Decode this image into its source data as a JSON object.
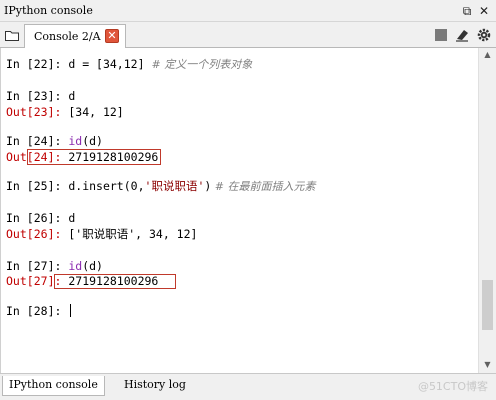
{
  "window": {
    "title": "IPython console",
    "undock_glyph": "⧉",
    "close_glyph": "✕"
  },
  "tabbar": {
    "tab_label": "Console 2/A",
    "tab_close_glyph": "✕"
  },
  "console": {
    "lines": [
      {
        "prompt": "In [",
        "num": "22",
        "close": "]: ",
        "code": "d = [34,12]",
        "comment": "  # 定义一个列表对象"
      },
      {
        "prompt": "In [",
        "num": "23",
        "close": "]: ",
        "code": "d"
      },
      {
        "prompt": "Out[",
        "num": "23",
        "close": "]: ",
        "code": "[34, 12]"
      },
      {
        "prompt": "In [",
        "num": "24",
        "close": "]: ",
        "code_kw": "id",
        "code_rest": "(d)"
      },
      {
        "prompt": "Out[",
        "num": "24",
        "close": "]: ",
        "code": "2719128100296"
      },
      {
        "prompt": "In [",
        "num": "25",
        "close": "]: ",
        "code_pre": "d.insert(0,",
        "code_str": "'职说职语'",
        "code_post": ")",
        "comment": " # 在最前面插入元素"
      },
      {
        "prompt": "In [",
        "num": "26",
        "close": "]: ",
        "code": "d"
      },
      {
        "prompt": "Out[",
        "num": "26",
        "close": "]: ",
        "code_pre": "[",
        "code_str": "'职说职语'",
        "code_post": ", 34, 12]"
      },
      {
        "prompt": "In [",
        "num": "27",
        "close": "]: ",
        "code_kw": "id",
        "code_rest": "(d)"
      },
      {
        "prompt": "Out[",
        "num": "27",
        "close": "]: ",
        "code": "2719128100296"
      },
      {
        "prompt": "In [",
        "num": "28",
        "close": "]: "
      }
    ]
  },
  "bottom_tabs": [
    {
      "label": "IPython console",
      "active": true
    },
    {
      "label": "History log",
      "active": false
    }
  ],
  "watermark": "@51CTO博客",
  "colors": {
    "prompt_in": "#000000",
    "prompt_out": "#c00000",
    "string": "#8b0000",
    "comment": "#808080",
    "builtin": "#8b2bb0",
    "highlight_box": "#c0392b"
  },
  "icons": [
    "folder-icon",
    "stop-icon",
    "eraser-icon",
    "gear-icon",
    "close-tab-icon",
    "undock-icon",
    "window-close-icon"
  ]
}
